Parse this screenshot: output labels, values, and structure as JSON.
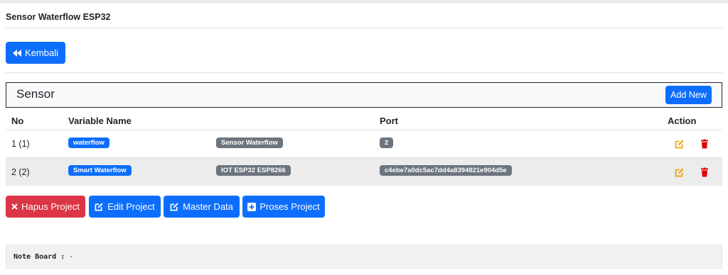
{
  "page": {
    "title": "Sensor Waterflow ESP32",
    "back_label": "Kembali"
  },
  "sensor_card": {
    "title": "Sensor",
    "add_label": "Add New"
  },
  "table": {
    "headers": {
      "no": "No",
      "variable": "Variable Name",
      "port": "Port",
      "action": "Action"
    },
    "rows": [
      {
        "no": "1 (1)",
        "variable": "waterflow",
        "device": "Sensor Waterflow",
        "port": "2"
      },
      {
        "no": "2 (2)",
        "variable": "Smart Waterflow",
        "device": "IOT ESP32 ESP8266",
        "port": "c4ebe7a0dc5ac7dd4a8394821e904d5e"
      }
    ]
  },
  "actions": {
    "hapus_label": "Hapus Project",
    "edit_label": "Edit Project",
    "master_label": "Master Data",
    "proses_label": "Proses Project"
  },
  "note": {
    "label": "Note Board :",
    "value": "-"
  },
  "colors": {
    "primary": "#0d6efd",
    "danger": "#dc3545",
    "secondary": "#6c757d",
    "edit_icon": "#f0a30a",
    "delete_icon": "#e00000"
  },
  "icons": {
    "back": "backward-icon",
    "edit": "edit-icon",
    "delete": "trash-icon",
    "close": "x-icon",
    "plus": "plus-square-icon"
  }
}
